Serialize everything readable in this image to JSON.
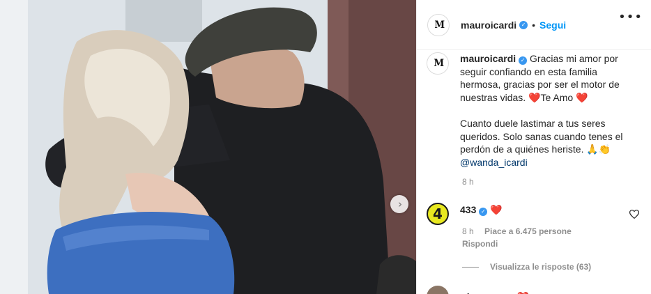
{
  "post": {
    "username": "mauroicardi",
    "avatar_monogram": "M",
    "follow_label": "Segui",
    "more_glyph": "•••",
    "verified_glyph": "✓",
    "dot_glyph": "•",
    "next_glyph": "›"
  },
  "caption": {
    "username": "mauroicardi",
    "line1": "Gracias mi amor por seguir confiando en esta familia hermosa, gracias por ser el motor de nuestras vidas. ",
    "heart1": "❤️",
    "te_amo": "Te Amo ",
    "heart2": "❤️",
    "para2": "Cuanto duele lastimar a tus seres queridos. Solo sanas cuando tenes el perdón de a quiénes heriste. 🙏👏",
    "mention": "@wanda_icardi",
    "time": "8 h"
  },
  "comments": [
    {
      "avatar_text": "4",
      "username": "433",
      "text": "❤️",
      "time": "8 h",
      "likes": "Piace a 6.475 persone",
      "reply_label": "Rispondi",
      "view_replies": "Visualizza le risposte (63)"
    },
    {
      "username": "alepapes",
      "text": "❤️"
    }
  ],
  "colors": {
    "accent": "#0095f6",
    "verified": "#3897f0",
    "heart": "#ed1c24",
    "muted": "#8e8e8e"
  }
}
